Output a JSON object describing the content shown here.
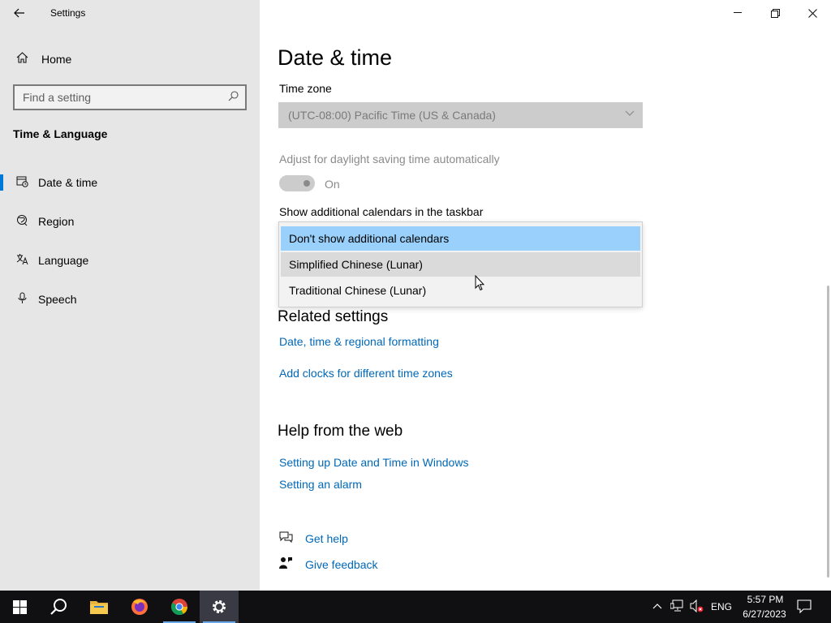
{
  "window": {
    "title": "Settings",
    "back_icon": "back-arrow-icon",
    "controls": {
      "minimize": "—",
      "restore": "❐",
      "close": "✕"
    }
  },
  "sidebar": {
    "home_label": "Home",
    "search_placeholder": "Find a setting",
    "section_title": "Time & Language",
    "items": [
      {
        "label": "Date & time",
        "icon": "calendar-clock-icon",
        "active": true
      },
      {
        "label": "Region",
        "icon": "globe-icon",
        "active": false
      },
      {
        "label": "Language",
        "icon": "language-icon",
        "active": false
      },
      {
        "label": "Speech",
        "icon": "microphone-icon",
        "active": false
      }
    ]
  },
  "main": {
    "title": "Date & time",
    "time_zone_label": "Time zone",
    "time_zone_value": "(UTC-08:00) Pacific Time (US & Canada)",
    "dst_label": "Adjust for daylight saving time automatically",
    "dst_toggle_state": "On",
    "calendars_label": "Show additional calendars in the taskbar",
    "calendar_options": [
      "Don't show additional calendars",
      "Simplified Chinese (Lunar)",
      "Traditional Chinese (Lunar)"
    ],
    "related_title": "Related settings",
    "related_links": [
      "Date, time & regional formatting",
      "Add clocks for different time zones"
    ],
    "help_title": "Help from the web",
    "help_links": [
      "Setting up Date and Time in Windows",
      "Setting an alarm"
    ],
    "get_help": "Get help",
    "give_feedback": "Give feedback"
  },
  "taskbar": {
    "apps": [
      "start-icon",
      "search-icon",
      "file-explorer-icon",
      "firefox-icon",
      "chrome-icon",
      "settings-icon"
    ],
    "lang": "ENG",
    "time": "5:57 PM",
    "date": "6/27/2023"
  },
  "colors": {
    "accent": "#0078d7",
    "link": "#0068b8",
    "selected": "#99d1fc",
    "taskbar": "#101013"
  }
}
